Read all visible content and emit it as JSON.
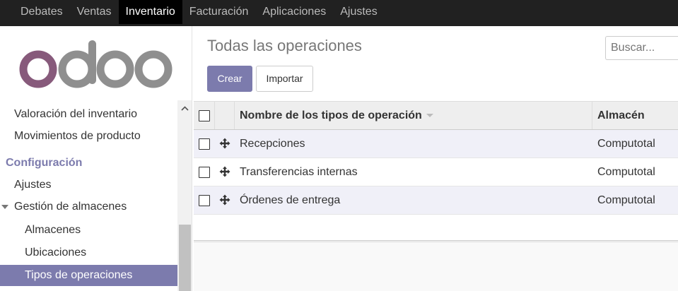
{
  "topbar": {
    "menu": [
      "Debates",
      "Ventas",
      "Inventario",
      "Facturación",
      "Aplicaciones",
      "Ajustes"
    ],
    "active": "Inventario"
  },
  "logo": {
    "text": "odoo"
  },
  "sidebar": {
    "items": [
      "Valoración del inventario",
      "Movimientos de producto"
    ],
    "section": "Configuración",
    "config_items": [
      "Ajustes",
      "Gestión de almacenes"
    ],
    "sub_items": [
      "Almacenes",
      "Ubicaciones",
      "Tipos de operaciones"
    ],
    "active": "Tipos de operaciones"
  },
  "control_panel": {
    "title": "Todas las operaciones",
    "create_label": "Crear",
    "import_label": "Importar",
    "search_placeholder": "Buscar..."
  },
  "table": {
    "columns": [
      "Nombre de los tipos de operación",
      "Almacén"
    ],
    "rows": [
      {
        "name": "Recepciones",
        "warehouse": "Computotal"
      },
      {
        "name": "Transferencias internas",
        "warehouse": "Computotal"
      },
      {
        "name": "Órdenes de entrega",
        "warehouse": "Computotal"
      }
    ]
  },
  "colors": {
    "brand": "#7c7bad",
    "navbar": "#212121",
    "logo_o": "#875a7b",
    "logo_gray": "#8f8f8f"
  }
}
